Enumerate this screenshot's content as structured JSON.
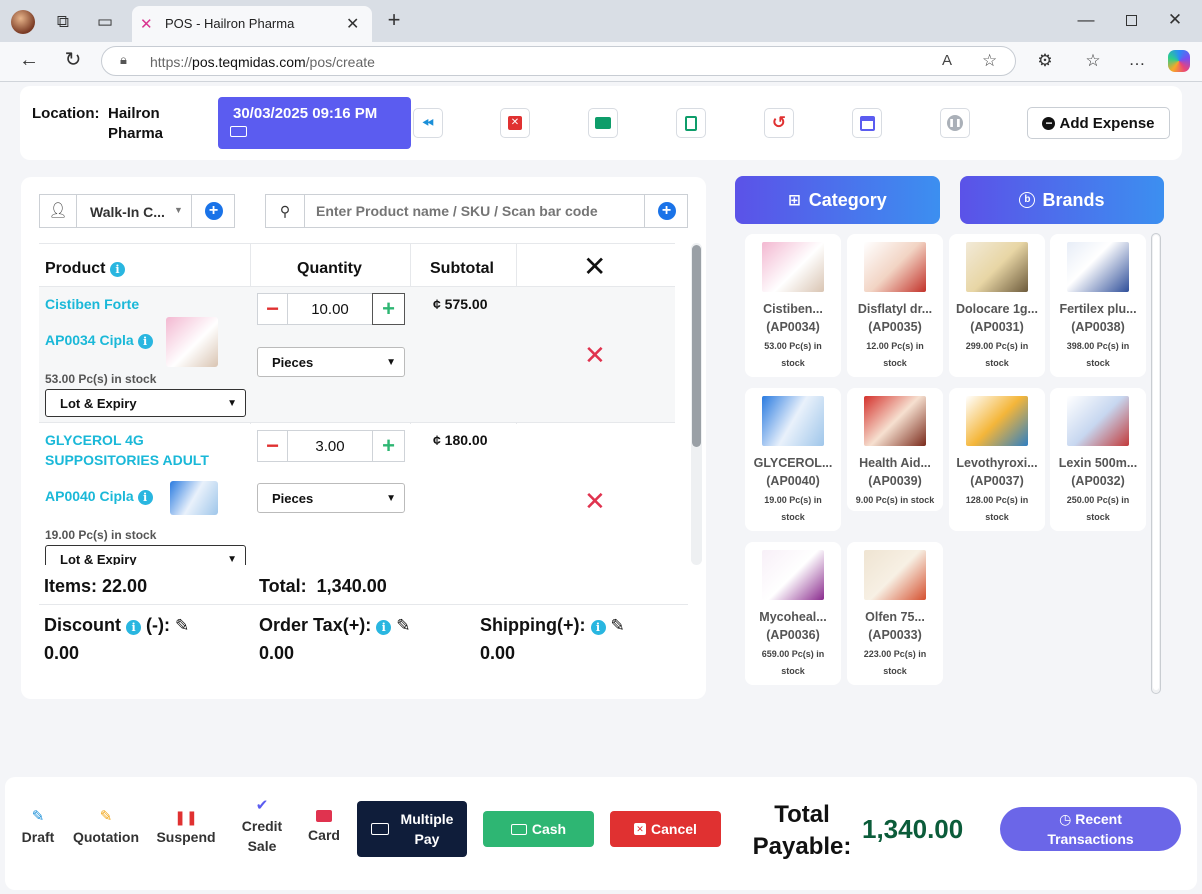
{
  "browser": {
    "tab_title": "POS - Hailron Pharma",
    "url_prefix": "https://",
    "url_host": "pos.teqmidas.com",
    "url_path": "/pos/create"
  },
  "header": {
    "location_label": "Location:",
    "location_line1": "Hailron",
    "location_line2": "Pharma",
    "datetime": "30/03/2025 09:16 PM",
    "add_expense": "Add Expense"
  },
  "customer": {
    "selected": "Walk-In C..."
  },
  "search": {
    "placeholder": "Enter Product name / SKU / Scan bar code"
  },
  "cart": {
    "headers": {
      "product": "Product",
      "quantity": "Quantity",
      "subtotal": "Subtotal"
    },
    "rows": [
      {
        "name": "Cistiben Forte",
        "sku": "AP0034 Cipla",
        "stock": "53.00 Pc(s) in stock",
        "qty": "10.00",
        "unit": "Pieces",
        "lot": "Lot & Expiry",
        "subtotal": "¢ 575.00"
      },
      {
        "name_line1": "GLYCEROL 4G",
        "name_line2": "SUPPOSITORIES ADULT",
        "sku": "AP0040 Cipla",
        "stock": "19.00 Pc(s) in stock",
        "qty": "3.00",
        "unit": "Pieces",
        "lot": "Lot & Expiry",
        "subtotal": "¢ 180.00"
      }
    ],
    "items_label": "Items:",
    "items_value": "22.00",
    "total_label": "Total:",
    "total_value": "1,340.00",
    "discount_label": "Discount",
    "discount_suffix": "(-):",
    "discount_value": "0.00",
    "tax_label": "Order Tax(+):",
    "tax_value": "0.00",
    "shipping_label": "Shipping(+):",
    "shipping_value": "0.00"
  },
  "tabs": {
    "category": "Category",
    "brands": "Brands"
  },
  "products": [
    {
      "name": "Cistiben...",
      "code": "(AP0034)",
      "stock1": "53.00 Pc(s) in",
      "stock2": "stock"
    },
    {
      "name": "Disflatyl dr...",
      "code": "(AP0035)",
      "stock1": "12.00 Pc(s) in",
      "stock2": "stock"
    },
    {
      "name": "Dolocare 1g...",
      "code": "(AP0031)",
      "stock1": "299.00 Pc(s) in",
      "stock2": "stock"
    },
    {
      "name": "Fertilex plu...",
      "code": "(AP0038)",
      "stock1": "398.00 Pc(s) in",
      "stock2": "stock"
    },
    {
      "name": "GLYCEROL...",
      "code": "(AP0040)",
      "stock1": "19.00 Pc(s) in",
      "stock2": "stock"
    },
    {
      "name": "Health Aid...",
      "code": "(AP0039)",
      "stock1": "9.00 Pc(s) in stock",
      "stock2": ""
    },
    {
      "name": "Levothyroxi...",
      "code": "(AP0037)",
      "stock1": "128.00 Pc(s) in",
      "stock2": "stock"
    },
    {
      "name": "Lexin 500m...",
      "code": "(AP0032)",
      "stock1": "250.00 Pc(s) in",
      "stock2": "stock"
    },
    {
      "name": "Mycoheal...",
      "code": "(AP0036)",
      "stock1": "659.00 Pc(s) in",
      "stock2": "stock"
    },
    {
      "name": "Olfen 75...",
      "code": "(AP0033)",
      "stock1": "223.00 Pc(s) in",
      "stock2": "stock"
    }
  ],
  "footer": {
    "draft": "Draft",
    "quotation": "Quotation",
    "suspend": "Suspend",
    "credit1": "Credit",
    "credit2": "Sale",
    "card": "Card",
    "multiple1": "Multiple",
    "multiple2": "Pay",
    "cash": "Cash",
    "cancel": "Cancel",
    "total1": "Total",
    "total2": "Payable:",
    "total_value": "1,340.00",
    "recent1": "Recent",
    "recent2": "Transactions"
  },
  "colors": {
    "accent": "#5b5cf0",
    "green": "#2eb673",
    "red": "#e03131",
    "navy": "#0f1d3a",
    "recent": "#6b66e8"
  }
}
